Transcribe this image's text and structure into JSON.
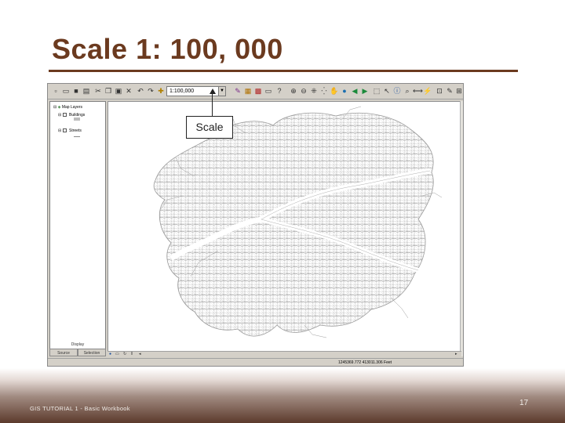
{
  "slide": {
    "title": "Scale 1: 100, 000",
    "footer": "GIS TUTORIAL 1 - Basic Workbook",
    "page_number": "17",
    "title_color": "#6b3a1f"
  },
  "arcmap": {
    "toolbar": {
      "scale_value": "1:100,000",
      "icons": [
        "new-icon",
        "open-icon",
        "save-icon",
        "print-icon",
        "cut-icon",
        "copy-icon",
        "paste-icon",
        "delete-icon",
        "undo-icon",
        "redo-icon",
        "add-data-icon",
        "scale-dropdown",
        "editor-icon",
        "arc-catalog-icon",
        "arc-toolbox-icon",
        "command-line-icon",
        "whats-this-icon",
        "zoom-in-icon",
        "zoom-out-icon",
        "fixed-zoom-in-icon",
        "fixed-zoom-out-icon",
        "pan-icon",
        "full-extent-icon",
        "back-icon",
        "forward-icon",
        "select-features-icon",
        "select-elements-icon",
        "identify-icon",
        "find-icon",
        "measure-icon",
        "hyperlink-icon"
      ]
    },
    "toc": {
      "layers": [
        {
          "label": "Map Layers",
          "level": 0
        },
        {
          "label": "Buildings",
          "level": 1
        },
        {
          "label": "Streets",
          "level": 1
        }
      ],
      "display_label": "Display",
      "tabs": [
        "Source",
        "Selection"
      ]
    },
    "status": {
      "coordinates": "1245369.772 413011.306 Feet"
    }
  },
  "callout": {
    "label": "Scale"
  }
}
